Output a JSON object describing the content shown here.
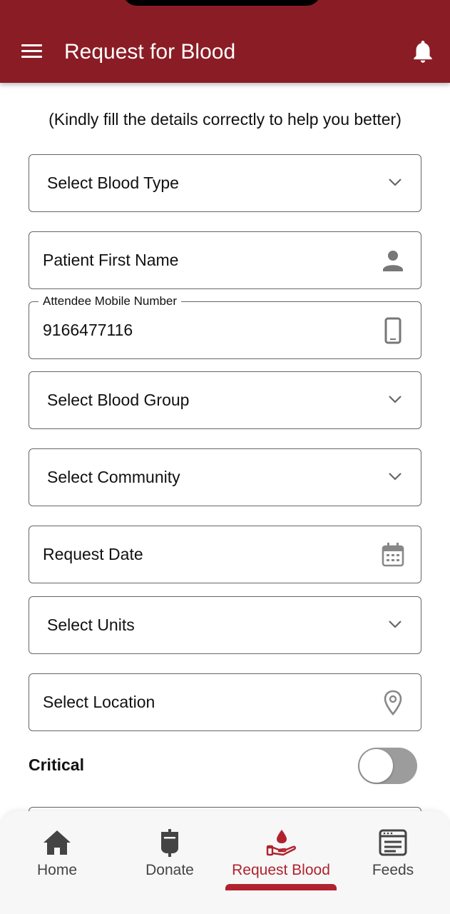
{
  "app_bar": {
    "title": "Request for Blood",
    "background_color": "#8a1c25",
    "menu_icon": "hamburger-menu-icon",
    "notification_icon": "bell-icon"
  },
  "form": {
    "hint": "(Kindly fill the details correctly to help you better)",
    "blood_type": {
      "placeholder": "Select Blood Type",
      "icon": "chevron-down-icon"
    },
    "patient_first_name": {
      "placeholder": "Patient First Name",
      "icon": "person-icon"
    },
    "attendee_mobile": {
      "label": "Attendee Mobile Number",
      "value": "9166477116",
      "icon": "mobile-phone-icon"
    },
    "blood_group": {
      "placeholder": "Select Blood Group",
      "icon": "chevron-down-icon"
    },
    "community": {
      "placeholder": "Select Community",
      "icon": "chevron-down-icon"
    },
    "request_date": {
      "placeholder": "Request Date",
      "icon": "calendar-icon"
    },
    "units": {
      "placeholder": "Select Units",
      "icon": "chevron-down-icon"
    },
    "location": {
      "placeholder": "Select Location",
      "icon": "location-pin-icon"
    },
    "critical": {
      "label": "Critical",
      "enabled": false
    }
  },
  "bottom_nav": {
    "active_color": "#b0232e",
    "items": [
      {
        "label": "Home",
        "icon": "home-icon",
        "active": false
      },
      {
        "label": "Donate",
        "icon": "blood-bag-icon",
        "active": false
      },
      {
        "label": "Request Blood",
        "icon": "blood-drop-hand-icon",
        "active": true
      },
      {
        "label": "Feeds",
        "icon": "feeds-icon",
        "active": false
      }
    ]
  }
}
